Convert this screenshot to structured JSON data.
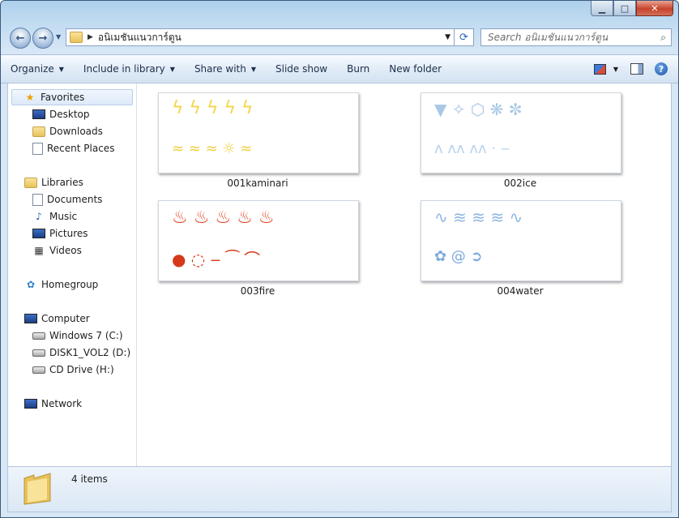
{
  "window": {
    "caption": {
      "minimize": "▁",
      "maximize": "□",
      "close": "✕"
    }
  },
  "address": {
    "path": "อนิเมชันแนวการ์ตูน",
    "search_placeholder": "Search อนิเมชันแนวการ์ตูน"
  },
  "toolbar": {
    "organize": "Organize",
    "include_in_library": "Include in library",
    "share_with": "Share with",
    "slide_show": "Slide show",
    "burn": "Burn",
    "new_folder": "New folder"
  },
  "nav": {
    "favorites": "Favorites",
    "desktop": "Desktop",
    "downloads": "Downloads",
    "recent_places": "Recent Places",
    "libraries": "Libraries",
    "documents": "Documents",
    "music": "Music",
    "pictures": "Pictures",
    "videos": "Videos",
    "homegroup": "Homegroup",
    "computer": "Computer",
    "windows7": "Windows 7 (C:)",
    "disk1": "DISK1_VOL2 (D:)",
    "cd_drive": "CD Drive (H:)",
    "network": "Network"
  },
  "files": [
    {
      "name": "001kaminari",
      "color": "#f3d64a"
    },
    {
      "name": "002ice",
      "color": "#a9c7e6"
    },
    {
      "name": "003fire",
      "color": "#e0401b"
    },
    {
      "name": "004water",
      "color": "#8fb6e3"
    }
  ],
  "status": {
    "count": "4 items"
  },
  "colors": {
    "accent": "#2a63b3",
    "toolbar_text": "#1b2f4a"
  }
}
